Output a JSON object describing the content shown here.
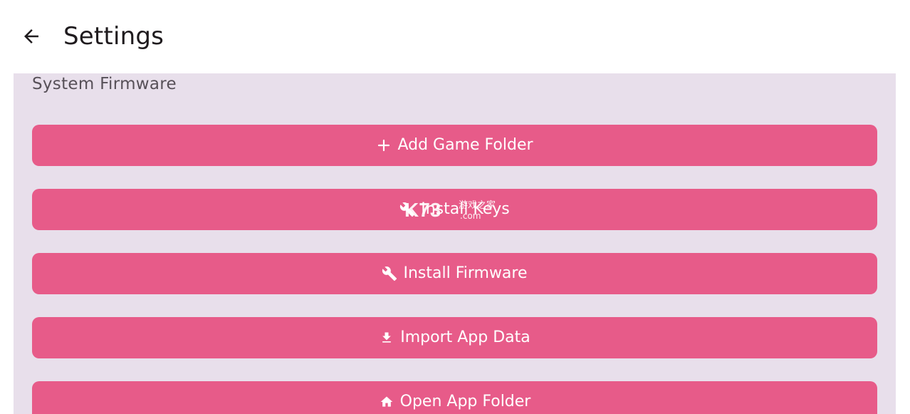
{
  "header": {
    "title": "Settings"
  },
  "section": {
    "title": "System Firmware"
  },
  "buttons": [
    {
      "label": "Add Game Folder",
      "icon": "plus-icon"
    },
    {
      "label": "Install Keys",
      "icon": "wrench-icon"
    },
    {
      "label": "Install Firmware",
      "icon": "wrench-icon"
    },
    {
      "label": "Import App Data",
      "icon": "download-icon"
    },
    {
      "label": "Open App Folder",
      "icon": "home-icon"
    }
  ],
  "watermark": {
    "text": "K73 游戏之家 .com"
  },
  "colors": {
    "button": "#e75b89",
    "panel": "#e8dfeb",
    "header_bg": "#ffffff",
    "title": "#1f1b1e",
    "section_title": "#575058"
  }
}
